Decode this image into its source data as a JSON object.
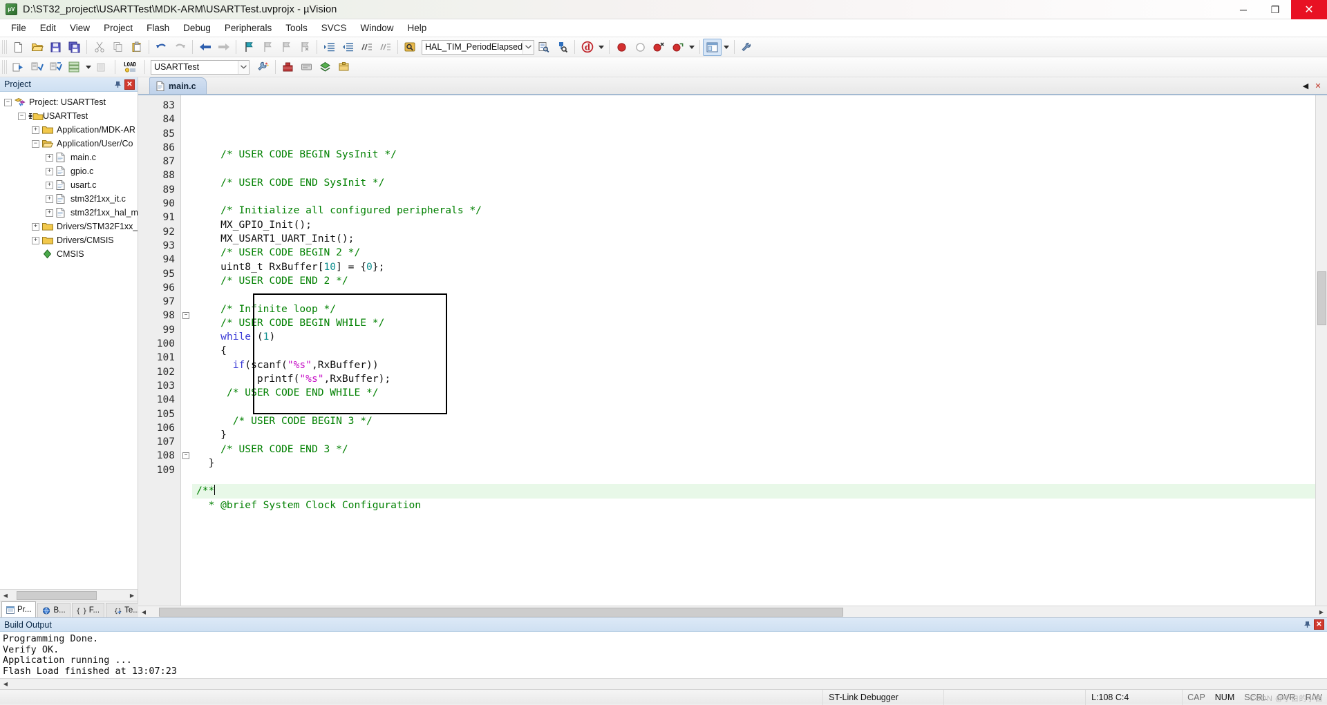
{
  "window": {
    "title": "D:\\ST32_project\\USARTTest\\MDK-ARM\\USARTTest.uvprojx - µVision",
    "app_icon": "uvision-icon",
    "minimize": "─",
    "maximize": "❐",
    "close": "✕"
  },
  "menu": {
    "items": [
      "File",
      "Edit",
      "View",
      "Project",
      "Flash",
      "Debug",
      "Peripherals",
      "Tools",
      "SVCS",
      "Window",
      "Help"
    ]
  },
  "toolbar_main": {
    "function_combo_value": "HAL_TIM_PeriodElapsedCall",
    "buttons": [
      "new-file-icon",
      "open-file-icon",
      "save-icon",
      "save-all-icon",
      "cut-icon",
      "copy-icon",
      "paste-icon",
      "undo-icon",
      "redo-icon",
      "navigate-back-icon",
      "navigate-forward-icon",
      "bookmark-toggle-icon",
      "bookmark-prev-icon",
      "bookmark-next-icon",
      "bookmark-clear-icon",
      "indent-icon",
      "outdent-icon",
      "comment-icon",
      "uncomment-icon",
      "find-in-files-icon",
      "browse-symbol-icon",
      "find-icon",
      "start-debug-icon",
      "insert-bookmark-icon",
      "breakpoint-icon",
      "disable-breakpoint-icon",
      "kill-breakpoints-icon",
      "enable-breakpoints-icon",
      "window-layout-icon",
      "configure-icon"
    ]
  },
  "toolbar_build": {
    "target_combo_value": "USARTTest",
    "buttons": [
      "translate-icon",
      "build-icon",
      "rebuild-icon",
      "batch-build-icon",
      "stop-build-icon",
      "load-icon",
      "target-options-icon",
      "manage-runtime-icon",
      "manage-project-items-icon",
      "configuration-wizard-icon",
      "multi-project-icon",
      "pack-installer-icon"
    ]
  },
  "project_panel": {
    "title": "Project",
    "pin_icon": "pin-icon",
    "close_icon": "close-icon",
    "tree": [
      {
        "label": "Project: USARTTest",
        "indent": 0,
        "expander": "−",
        "icon": "project-icon"
      },
      {
        "label": "USARTTest",
        "indent": 1,
        "expander": "−",
        "icon": "target-icon"
      },
      {
        "label": "Application/MDK-AR",
        "indent": 2,
        "expander": "+",
        "icon": "folder-closed-icon"
      },
      {
        "label": "Application/User/Co",
        "indent": 2,
        "expander": "−",
        "icon": "folder-open-icon"
      },
      {
        "label": "main.c",
        "indent": 3,
        "expander": "+",
        "icon": "c-file-icon"
      },
      {
        "label": "gpio.c",
        "indent": 3,
        "expander": "+",
        "icon": "c-file-icon"
      },
      {
        "label": "usart.c",
        "indent": 3,
        "expander": "+",
        "icon": "c-file-icon"
      },
      {
        "label": "stm32f1xx_it.c",
        "indent": 3,
        "expander": "+",
        "icon": "c-file-icon"
      },
      {
        "label": "stm32f1xx_hal_m",
        "indent": 3,
        "expander": "+",
        "icon": "c-file-icon"
      },
      {
        "label": "Drivers/STM32F1xx_",
        "indent": 2,
        "expander": "+",
        "icon": "folder-closed-icon"
      },
      {
        "label": "Drivers/CMSIS",
        "indent": 2,
        "expander": "+",
        "icon": "folder-closed-icon"
      },
      {
        "label": "CMSIS",
        "indent": 2,
        "expander": "",
        "icon": "cmsis-icon"
      }
    ],
    "tabs": [
      {
        "label": "Pr...",
        "icon": "project-tab-icon",
        "active": true
      },
      {
        "label": "B...",
        "icon": "books-tab-icon",
        "active": false
      },
      {
        "label": "F...",
        "icon": "functions-tab-icon",
        "active": false
      },
      {
        "label": "Te...",
        "icon": "templates-tab-icon",
        "active": false
      }
    ]
  },
  "editor": {
    "tabs": [
      {
        "label": "main.c",
        "icon": "c-file-icon",
        "active": true
      }
    ],
    "tab_scroll_left": "◀",
    "tab_scroll_right": "▶",
    "tab_close": "✕",
    "first_line_number": 83,
    "highlight_line": 108,
    "lines": [
      {
        "n": 83,
        "fold": "",
        "tokens": []
      },
      {
        "n": 84,
        "fold": "",
        "tokens": [
          {
            "t": "    ",
            "c": ""
          },
          {
            "t": "/* USER CODE BEGIN SysInit */",
            "c": "cmt"
          }
        ]
      },
      {
        "n": 85,
        "fold": "",
        "tokens": []
      },
      {
        "n": 86,
        "fold": "",
        "tokens": [
          {
            "t": "    ",
            "c": ""
          },
          {
            "t": "/* USER CODE END SysInit */",
            "c": "cmt"
          }
        ]
      },
      {
        "n": 87,
        "fold": "",
        "tokens": []
      },
      {
        "n": 88,
        "fold": "",
        "tokens": [
          {
            "t": "    ",
            "c": ""
          },
          {
            "t": "/* Initialize all configured peripherals */",
            "c": "cmt"
          }
        ]
      },
      {
        "n": 89,
        "fold": "",
        "tokens": [
          {
            "t": "    MX_GPIO_Init();",
            "c": ""
          }
        ]
      },
      {
        "n": 90,
        "fold": "",
        "tokens": [
          {
            "t": "    MX_USART1_UART_Init();",
            "c": ""
          }
        ]
      },
      {
        "n": 91,
        "fold": "",
        "tokens": [
          {
            "t": "    ",
            "c": ""
          },
          {
            "t": "/* USER CODE BEGIN 2 */",
            "c": "cmt"
          }
        ]
      },
      {
        "n": 92,
        "fold": "",
        "tokens": [
          {
            "t": "    uint8_t RxBuffer[",
            "c": ""
          },
          {
            "t": "10",
            "c": "num"
          },
          {
            "t": "] = {",
            "c": ""
          },
          {
            "t": "0",
            "c": "num"
          },
          {
            "t": "};",
            "c": ""
          }
        ]
      },
      {
        "n": 93,
        "fold": "",
        "tokens": [
          {
            "t": "    ",
            "c": ""
          },
          {
            "t": "/* USER CODE END 2 */",
            "c": "cmt"
          }
        ]
      },
      {
        "n": 94,
        "fold": "",
        "tokens": []
      },
      {
        "n": 95,
        "fold": "",
        "tokens": [
          {
            "t": "    ",
            "c": ""
          },
          {
            "t": "/* Infinite loop */",
            "c": "cmt"
          }
        ]
      },
      {
        "n": 96,
        "fold": "",
        "tokens": [
          {
            "t": "    ",
            "c": ""
          },
          {
            "t": "/* USER CODE BEGIN WHILE */",
            "c": "cmt"
          }
        ]
      },
      {
        "n": 97,
        "fold": "",
        "tokens": [
          {
            "t": "    ",
            "c": ""
          },
          {
            "t": "while",
            "c": "kw"
          },
          {
            "t": " (",
            "c": ""
          },
          {
            "t": "1",
            "c": "num"
          },
          {
            "t": ")",
            "c": ""
          }
        ]
      },
      {
        "n": 98,
        "fold": "−",
        "tokens": [
          {
            "t": "    {",
            "c": ""
          }
        ]
      },
      {
        "n": 99,
        "fold": "",
        "tokens": [
          {
            "t": "      ",
            "c": ""
          },
          {
            "t": "if",
            "c": "kw"
          },
          {
            "t": "(scanf(",
            "c": ""
          },
          {
            "t": "\"%s\"",
            "c": "str"
          },
          {
            "t": ",RxBuffer))",
            "c": ""
          }
        ]
      },
      {
        "n": 100,
        "fold": "",
        "tokens": [
          {
            "t": "          printf(",
            "c": ""
          },
          {
            "t": "\"%s\"",
            "c": "str"
          },
          {
            "t": ",RxBuffer);",
            "c": ""
          }
        ]
      },
      {
        "n": 101,
        "fold": "",
        "tokens": [
          {
            "t": "     ",
            "c": ""
          },
          {
            "t": "/* USER CODE END WHILE */",
            "c": "cmt"
          }
        ]
      },
      {
        "n": 102,
        "fold": "",
        "tokens": []
      },
      {
        "n": 103,
        "fold": "",
        "tokens": [
          {
            "t": "      ",
            "c": ""
          },
          {
            "t": "/* USER CODE BEGIN 3 */",
            "c": "cmt"
          }
        ]
      },
      {
        "n": 104,
        "fold": "",
        "tokens": [
          {
            "t": "    }",
            "c": ""
          }
        ]
      },
      {
        "n": 105,
        "fold": "",
        "tokens": [
          {
            "t": "    ",
            "c": ""
          },
          {
            "t": "/* USER CODE END 3 */",
            "c": "cmt"
          }
        ]
      },
      {
        "n": 106,
        "fold": "",
        "tokens": [
          {
            "t": "  }",
            "c": ""
          }
        ]
      },
      {
        "n": 107,
        "fold": "",
        "tokens": []
      },
      {
        "n": 108,
        "fold": "−",
        "tokens": [
          {
            "t": "/**",
            "c": "cmt"
          }
        ]
      },
      {
        "n": 109,
        "fold": "",
        "tokens": [
          {
            "t": "  * @brief System Clock Configuration",
            "c": "cmt"
          }
        ]
      }
    ]
  },
  "build_output": {
    "title": "Build Output",
    "pin_icon": "pin-icon",
    "close_icon": "close-icon",
    "lines": [
      "Programming Done.",
      "Verify OK.",
      "Application running ...",
      "Flash Load finished at 13:07:23"
    ]
  },
  "status_bar": {
    "debugger": "ST-Link Debugger",
    "position": "L:108 C:4",
    "indicators": [
      "CAP",
      "NUM",
      "SCRL",
      "OVR",
      "R/W"
    ],
    "watermark": "CSDN @小白的小白"
  },
  "colors": {
    "accent": "#cfe0f2",
    "comment": "#008000",
    "keyword": "#3b3bd6",
    "string": "#c814c8",
    "number": "#0f8f8f",
    "close_red": "#e81123",
    "highlight_line_bg": "#e8f8e8"
  }
}
